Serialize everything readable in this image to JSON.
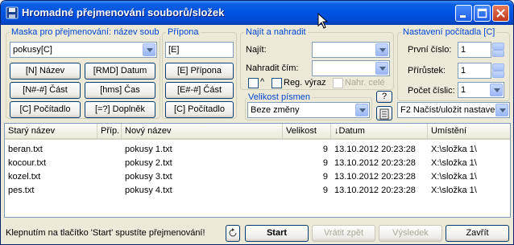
{
  "window": {
    "title": "Hromadné přejmenování souborů/složek"
  },
  "mask": {
    "legend": "Maska pro přejmenování: název soub",
    "value": "pokusy[C]",
    "buttons": [
      "[N] Název",
      "[RMD] Datum",
      "[N#-#] Část",
      "[hms] Čas",
      "[C] Počítadlo",
      "[=?] Doplněk"
    ]
  },
  "extension": {
    "legend": "Přípona",
    "value": "[E]",
    "buttons": [
      "[E] Přípona",
      "[E#-#] Část",
      "[C] Počítadlo"
    ]
  },
  "find": {
    "legend": "Najít a nahradit",
    "find_label": "Najít:",
    "find_value": "",
    "replace_label": "Nahradit čím:",
    "replace_value": "",
    "case_symbol": "^",
    "regex_label": "Reg. výraz",
    "whole_label": "Nahr. celé"
  },
  "case": {
    "legend": "Velikost písmen",
    "value": "Beze změny",
    "help": "?"
  },
  "counter": {
    "legend": "Nastavení počítadla [C]",
    "start_label": "První číslo:",
    "start_value": "1",
    "step_label": "Přírůstek:",
    "step_value": "1",
    "digits_label": "Počet číslic:",
    "digits_value": "1",
    "preset_value": "F2 Načíst/uložit nastave"
  },
  "list": {
    "columns": [
      "Starý název",
      "Příp.",
      "Nový název",
      "Velikost",
      "Datum",
      "Umístění"
    ],
    "sort_indicator": "↓",
    "rows": [
      {
        "old": "beran.txt",
        "ext": "",
        "new": "pokusy 1.txt",
        "size": "9",
        "date": "13.10.2012 20:23:28",
        "loc": "X:\\složka 1\\"
      },
      {
        "old": "kocour.txt",
        "ext": "",
        "new": "pokusy 2.txt",
        "size": "9",
        "date": "13.10.2012 20:23:28",
        "loc": "X:\\složka 1\\"
      },
      {
        "old": "kozel.txt",
        "ext": "",
        "new": "pokusy 3.txt",
        "size": "9",
        "date": "13.10.2012 20:23:28",
        "loc": "X:\\složka 1\\"
      },
      {
        "old": "pes.txt",
        "ext": "",
        "new": "pokusy 4.txt",
        "size": "9",
        "date": "13.10.2012 20:23:28",
        "loc": "X:\\složka 1\\"
      }
    ]
  },
  "footer": {
    "status": "Klepnutím na tlačítko 'Start' spustíte přejmenování!",
    "start": "Start",
    "undo": "Vrátit zpět",
    "results": "Výsledek",
    "close": "Zavřít"
  }
}
